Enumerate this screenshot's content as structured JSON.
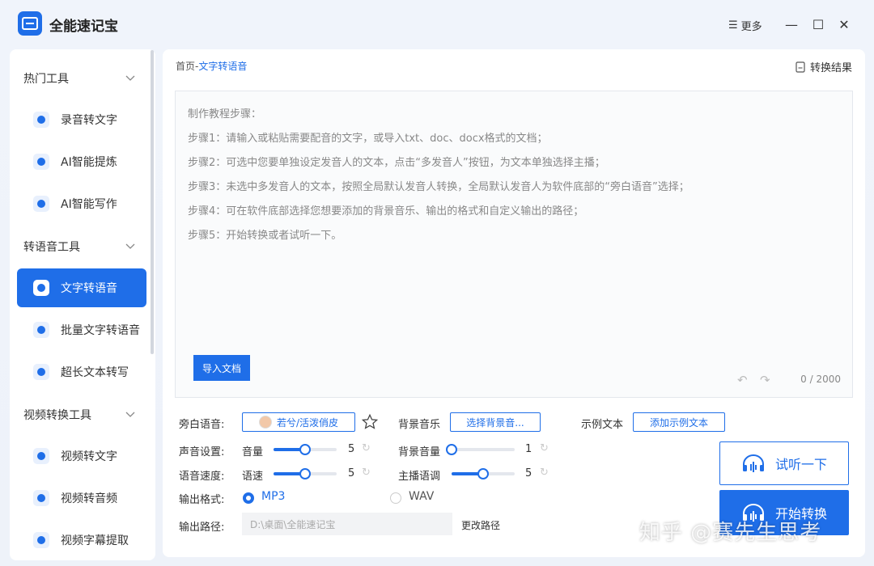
{
  "app": {
    "title": "全能速记宝",
    "more_label": "更多"
  },
  "sidebar": {
    "sections": [
      {
        "title": "热门工具",
        "items": [
          {
            "label": "录音转文字"
          },
          {
            "label": "AI智能提炼"
          },
          {
            "label": "AI智能写作"
          }
        ]
      },
      {
        "title": "转语音工具",
        "items": [
          {
            "label": "文字转语音"
          },
          {
            "label": "批量文字转语音"
          },
          {
            "label": "超长文本转写"
          }
        ]
      },
      {
        "title": "视频转换工具",
        "items": [
          {
            "label": "视频转文字"
          },
          {
            "label": "视频转音频"
          },
          {
            "label": "视频字幕提取"
          }
        ]
      }
    ],
    "active_item": "文字转语音"
  },
  "main": {
    "breadcrumb": {
      "home": "首页",
      "separator": "-",
      "current": "文字转语音"
    },
    "result_link": "转换结果",
    "editor": {
      "lines": [
        "制作教程步骤：",
        "步骤1：请输入或粘贴需要配音的文字，或导入txt、doc、docx格式的文档；",
        "步骤2：可选中您要单独设定发音人的文本，点击“多发音人”按钮，为文本单独选择主播；",
        "步骤3：未选中多发音人的文本，按照全局默认发音人转换，全局默认发音人为软件底部的“旁白语音”选择；",
        "步骤4：可在软件底部选择您想要添加的背景音乐、输出的格式和自定义输出的路径；",
        "步骤5：开始转换或者试听一下。"
      ],
      "import_button": "导入文档",
      "counter": "0 / 2000"
    },
    "settings": {
      "narration_label": "旁白语音:",
      "voice_name": "若兮/活泼俏皮",
      "bgm_label": "背景音乐",
      "bgm_button": "选择背景音...",
      "sample_label": "示例文本",
      "sample_button": "添加示例文本",
      "sound_label": "声音设置:",
      "volume_label": "音量",
      "volume_value": "5",
      "volume_fraction": 0.5,
      "bg_volume_label": "背景音量",
      "bg_volume_value": "1",
      "bg_volume_fraction": 0.0,
      "speed_row_label": "语音速度:",
      "speed_label": "语速",
      "speed_value": "5",
      "speed_fraction": 0.5,
      "pitch_label": "主播语调",
      "pitch_value": "5",
      "pitch_fraction": 0.5,
      "format_label": "输出格式:",
      "format_mp3": "MP3",
      "format_wav": "WAV",
      "selected_format": "MP3",
      "path_label": "输出路径:",
      "path_value": "D:\\桌面\\全能速记宝",
      "change_path": "更改路径"
    },
    "preview_button": "试听一下",
    "start_button": "开始转换"
  },
  "watermark": "知乎 @赛先生思考",
  "colors": {
    "accent": "#1f6ee8",
    "background": "#eef2f9"
  }
}
